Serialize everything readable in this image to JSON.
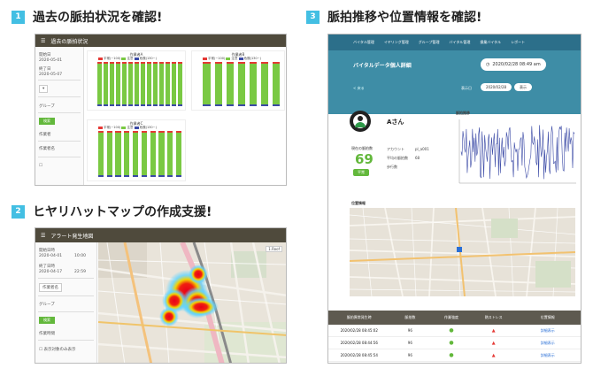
{
  "colors": {
    "accent_badge": "#43bfe3",
    "titlebar": "#4f4a3c",
    "green": "#63b83c",
    "blue_nav": "#2c6f8a",
    "bar_green": "#7ac943",
    "line_blue": "#3b4aa6"
  },
  "sections": [
    {
      "number": "1",
      "title": "過去の脈拍状況を確認!"
    },
    {
      "number": "2",
      "title": "ヒヤリハットマップの作成支援!"
    },
    {
      "number": "3",
      "title": "脈拍推移や位置情報を確認!"
    }
  ],
  "panel1": {
    "window_title": "過去の脈拍状況",
    "sidebar": {
      "rows": [
        "開始日",
        "2020-05-01",
        "終了日",
        "2020-05-07",
        "グループ",
        "作業者",
        "作業者名"
      ],
      "button": "検索"
    },
    "legend": [
      "平常(~100)",
      "注意",
      "危険(130~)"
    ],
    "charts": [
      {
        "title": "作業者A"
      },
      {
        "title": "作業者B"
      },
      {
        "title": "作業者C"
      }
    ]
  },
  "panel2": {
    "window_title": "アラート発生地図",
    "sidebar": {
      "rows": [
        "開始日時",
        "2020-04-01",
        "10:00",
        "終了日時",
        "2020-04-17",
        "22:59",
        "作業者名",
        "グループ",
        "作業時間"
      ],
      "button": "検索",
      "checkbox": "表示対象のみ表示"
    },
    "map_corner": "1.Roof"
  },
  "panel3": {
    "nav": [
      "バイタル管理",
      "イヤリング管理",
      "グループ管理",
      "バイタル管理",
      "操業バイタル",
      "レポート"
    ],
    "page_title": "バイタルデータ個人詳細",
    "datetime": "2020/02/28 08:49 am",
    "back_link": "< 戻る",
    "date_label": "表示日",
    "date_value": "2020/02/28",
    "reload_btn": "表示",
    "worker_name": "Aさん",
    "pulse_label": "現在の脈拍数",
    "pulse_value": "69",
    "pulse_status": "平常",
    "info_rows": [
      [
        "アカウント",
        "pl_a001"
      ],
      [
        "平均の脈拍数",
        "68"
      ],
      [
        "歩行数",
        ""
      ]
    ],
    "chart_title": "脈拍推移",
    "map_title": "位置情報",
    "table": {
      "headers": [
        "脈拍異常発生時",
        "脈拍数",
        "作業強度",
        "熱ストレス",
        "位置情報"
      ],
      "rows": [
        [
          "2020/02/28 08:45:02",
          "96",
          "●",
          "▲",
          "詳細表示"
        ],
        [
          "2020/02/28 08:44:56",
          "96",
          "●",
          "▲",
          "詳細表示"
        ],
        [
          "2020/02/28 08:45:54",
          "96",
          "●",
          "▲",
          "詳細表示"
        ]
      ]
    }
  }
}
